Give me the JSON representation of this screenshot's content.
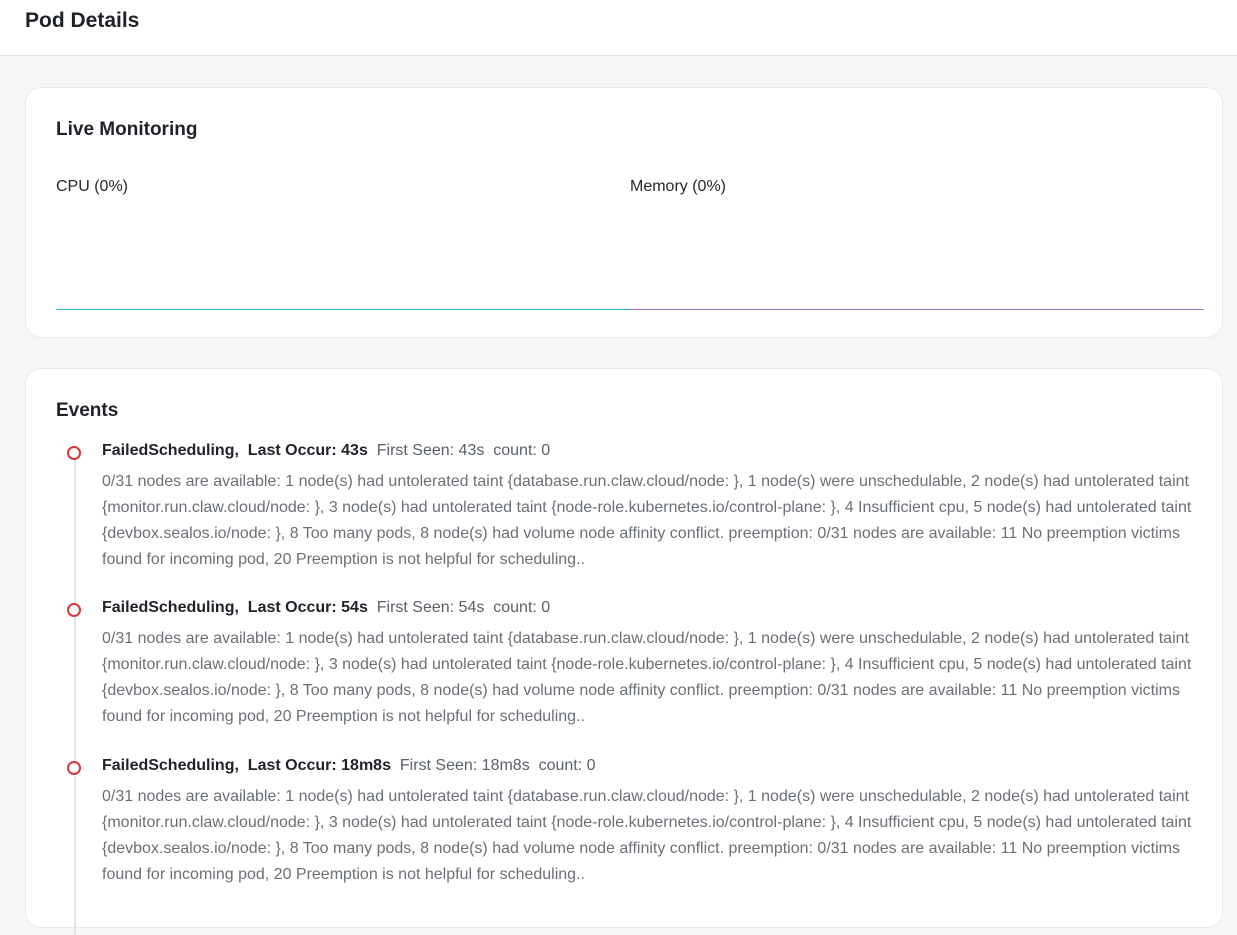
{
  "header": {
    "title": "Pod Details"
  },
  "monitoring": {
    "title": "Live Monitoring",
    "cpu_label": "CPU (0%)",
    "memory_label": "Memory (0%)",
    "cpu_color": "#35b8c9",
    "memory_color": "#9b77d4"
  },
  "events": {
    "title": "Events",
    "items": [
      {
        "reason": "FailedScheduling,",
        "last_occur": "Last Occur: 43s",
        "first_seen": "First Seen: 43s",
        "count": "count: 0",
        "message": "0/31 nodes are available: 1 node(s) had untolerated taint {database.run.claw.cloud/node: }, 1 node(s) were unschedulable, 2 node(s) had untolerated taint {monitor.run.claw.cloud/node: }, 3 node(s) had untolerated taint {node-role.kubernetes.io/control-plane: }, 4 Insufficient cpu, 5 node(s) had untolerated taint {devbox.sealos.io/node: }, 8 Too many pods, 8 node(s) had volume node affinity conflict. preemption: 0/31 nodes are available: 11 No preemption victims found for incoming pod, 20 Preemption is not helpful for scheduling.."
      },
      {
        "reason": "FailedScheduling,",
        "last_occur": "Last Occur: 54s",
        "first_seen": "First Seen: 54s",
        "count": "count: 0",
        "message": "0/31 nodes are available: 1 node(s) had untolerated taint {database.run.claw.cloud/node: }, 1 node(s) were unschedulable, 2 node(s) had untolerated taint {monitor.run.claw.cloud/node: }, 3 node(s) had untolerated taint {node-role.kubernetes.io/control-plane: }, 4 Insufficient cpu, 5 node(s) had untolerated taint {devbox.sealos.io/node: }, 8 Too many pods, 8 node(s) had volume node affinity conflict. preemption: 0/31 nodes are available: 11 No preemption victims found for incoming pod, 20 Preemption is not helpful for scheduling.."
      },
      {
        "reason": "FailedScheduling,",
        "last_occur": "Last Occur: 18m8s",
        "first_seen": "First Seen: 18m8s",
        "count": "count: 0",
        "message": "0/31 nodes are available: 1 node(s) had untolerated taint {database.run.claw.cloud/node: }, 1 node(s) were unschedulable, 2 node(s) had untolerated taint {monitor.run.claw.cloud/node: }, 3 node(s) had untolerated taint {node-role.kubernetes.io/control-plane: }, 4 Insufficient cpu, 5 node(s) had untolerated taint {devbox.sealos.io/node: }, 8 Too many pods, 8 node(s) had volume node affinity conflict. preemption: 0/31 nodes are available: 11 No preemption victims found for incoming pod, 20 Preemption is not helpful for scheduling.."
      }
    ]
  }
}
